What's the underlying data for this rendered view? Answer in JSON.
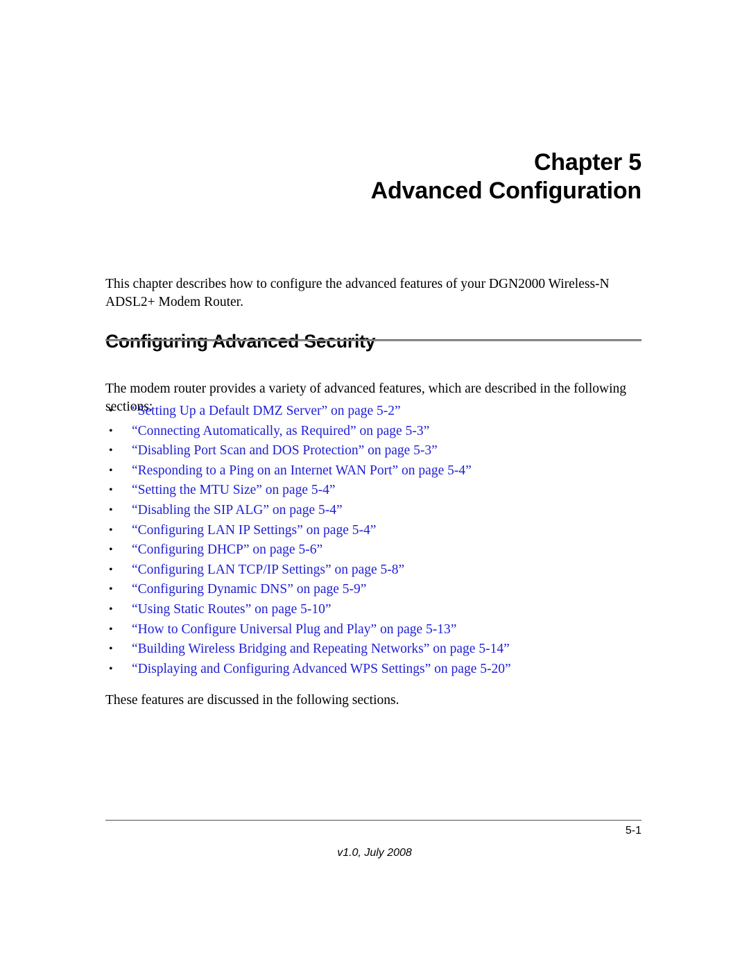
{
  "document": {
    "background_color": "#ffffff",
    "link_color": "#2020d8",
    "rule_color": "#8c8c8c"
  },
  "chapter": {
    "label": "Chapter",
    "number": "5",
    "title": "Advanced Configuration"
  },
  "intro": {
    "paragraph": "This chapter describes how to configure the advanced features of your DGN2000 Wireless-N ADSL2+ Modem Router."
  },
  "section": {
    "heading": "Configuring Advanced Security",
    "lead_paragraph": "The modem router provides a variety of advanced features, which are described in the following sections:",
    "closing_paragraph": "These features are discussed in the following sections."
  },
  "bullet_glyph": "•",
  "links": [
    {
      "text": "“Setting Up a Default DMZ Server” on page 5-2”"
    },
    {
      "text": "“Connecting Automatically, as Required” on page 5-3”"
    },
    {
      "text": "“Disabling Port Scan and DOS Protection” on page 5-3”"
    },
    {
      "text": "“Responding to a Ping on an Internet WAN Port” on page 5-4”"
    },
    {
      "text": "“Setting the MTU Size” on page 5-4”"
    },
    {
      "text": "“Disabling the SIP ALG” on page 5-4”"
    },
    {
      "text": "“Configuring LAN IP Settings” on page 5-4”"
    },
    {
      "text": "“Configuring DHCP” on page 5-6”"
    },
    {
      "text": "“Configuring LAN TCP/IP Settings” on page 5-8”"
    },
    {
      "text": "“Configuring Dynamic DNS” on page 5-9”"
    },
    {
      "text": "“Using Static Routes” on page 5-10”"
    },
    {
      "text": "“How to Configure Universal Plug and Play” on page 5-13”"
    },
    {
      "text": "“Building Wireless Bridging and Repeating Networks” on page 5-14”"
    },
    {
      "text": "“Displaying and Configuring Advanced WPS Settings” on page 5-20”"
    }
  ],
  "footer": {
    "page_number": "5-1",
    "version": "v1.0, July 2008"
  }
}
